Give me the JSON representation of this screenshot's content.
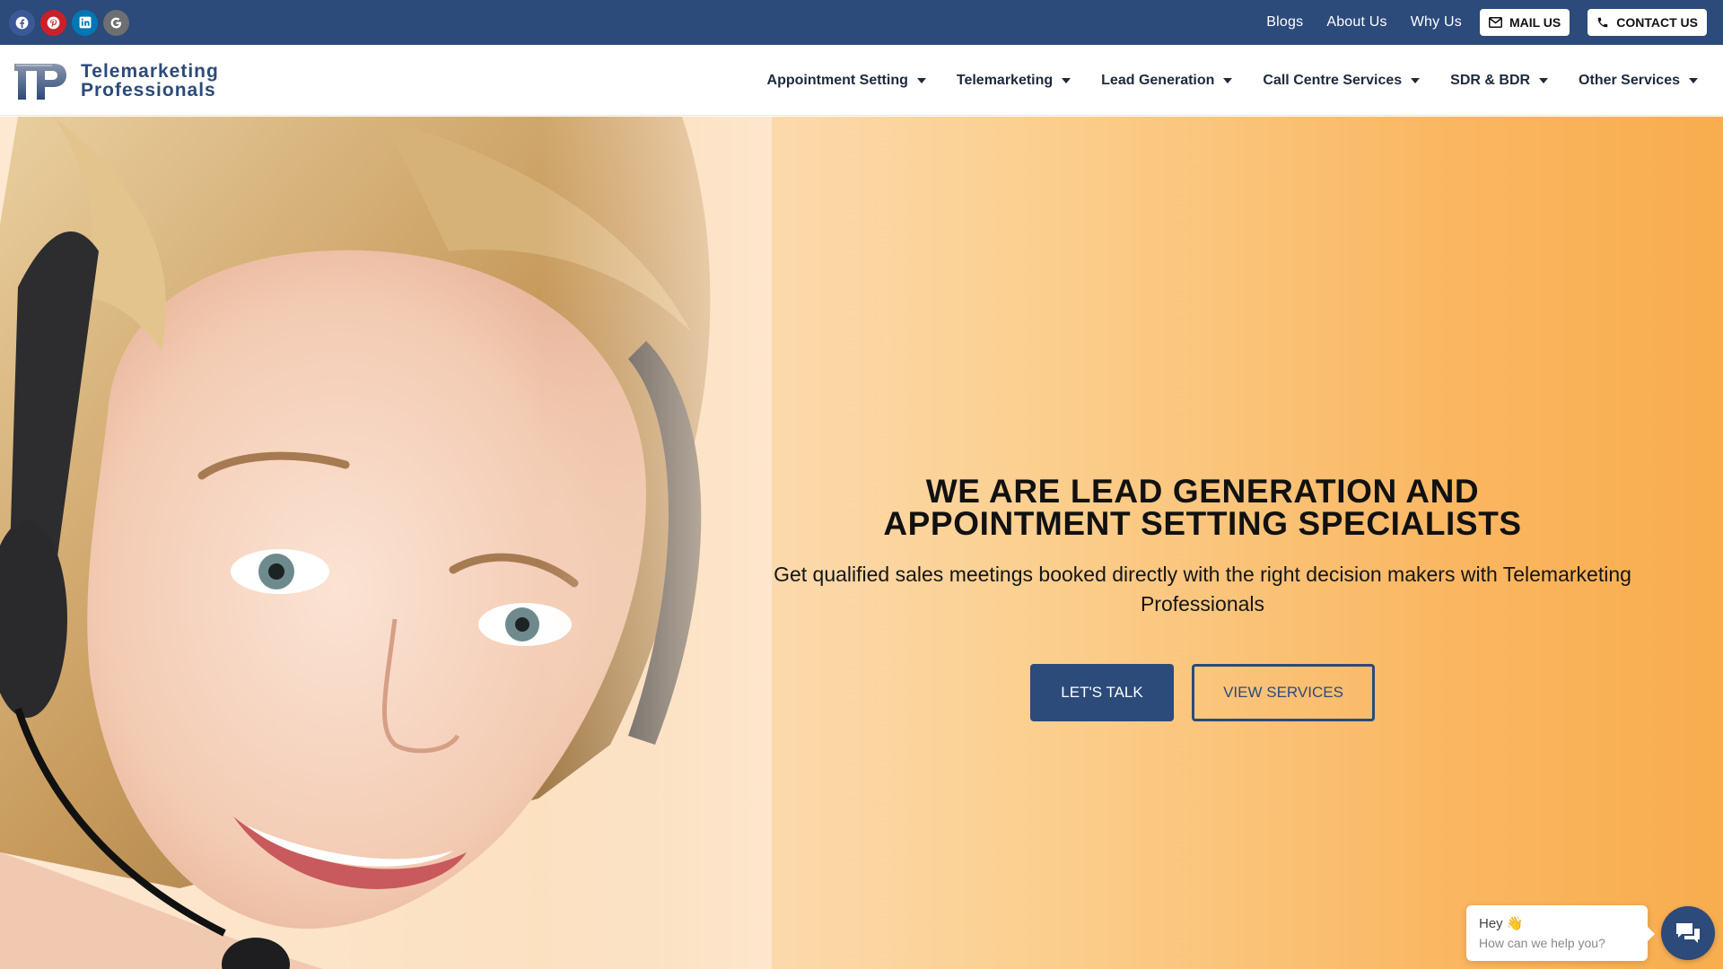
{
  "topbar": {
    "social": [
      {
        "name": "facebook-icon",
        "glyph": "f"
      },
      {
        "name": "pinterest-icon",
        "glyph": "P"
      },
      {
        "name": "linkedin-icon",
        "glyph": "in"
      },
      {
        "name": "google-icon",
        "glyph": "G"
      }
    ],
    "links": [
      "Blogs",
      "About Us",
      "Why Us"
    ],
    "mail_label": "MAIL US",
    "contact_label": "CONTACT US"
  },
  "header": {
    "logo_line1": "Telemarketing",
    "logo_line2": "Professionals",
    "nav": [
      {
        "label": "Appointment Setting"
      },
      {
        "label": "Telemarketing"
      },
      {
        "label": "Lead Generation"
      },
      {
        "label": "Call Centre Services"
      },
      {
        "label": "SDR & BDR"
      },
      {
        "label": "Other Services"
      }
    ]
  },
  "hero": {
    "title_line1": "WE ARE LEAD GENERATION AND",
    "title_line2": "APPOINTMENT SETTING SPECIALISTS",
    "subtitle": "Get qualified sales meetings booked directly with the right decision makers with Telemarketing Professionals",
    "primary_button": "LET'S TALK",
    "secondary_button": "VIEW SERVICES"
  },
  "chat": {
    "greeting": "Hey 👋",
    "prompt": "How can we help you?"
  },
  "colors": {
    "brand": "#2c4a7a",
    "hero_gradient_start": "#fde8d2",
    "hero_gradient_end": "#f8ad4e"
  }
}
